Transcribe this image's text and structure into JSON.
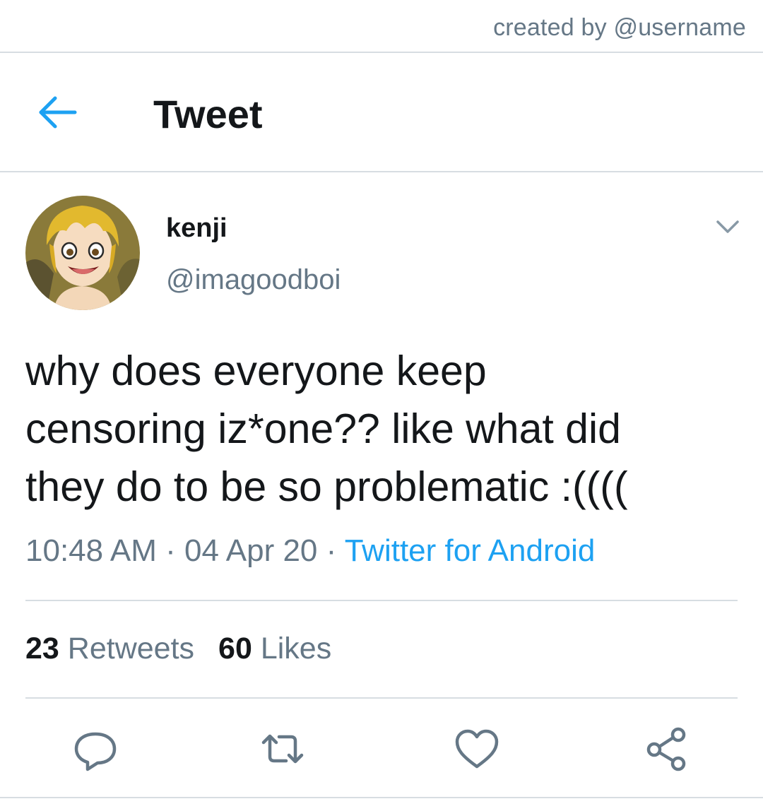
{
  "watermark": "created by @username",
  "header": {
    "title": "Tweet",
    "back_icon": "back-arrow-icon",
    "accent_color": "#1da1f2"
  },
  "tweet": {
    "display_name": "kenji",
    "handle": "@imagoodboi",
    "text_lines": [
      "why does everyone keep",
      "censoring iz*one?? like what did",
      "they do to be so problematic :(((("
    ],
    "time": "10:48 AM",
    "date": "04 Apr 20",
    "separator": "·",
    "source": "Twitter for Android",
    "stats": {
      "retweets_count": "23",
      "retweets_label": "Retweets",
      "likes_count": "60",
      "likes_label": "Likes"
    }
  },
  "actions": [
    "reply-icon",
    "retweet-icon",
    "like-icon",
    "share-icon"
  ],
  "colors": {
    "text_primary": "#14171a",
    "text_secondary": "#657786",
    "divider": "#d7dde2",
    "link": "#1da1f2"
  }
}
